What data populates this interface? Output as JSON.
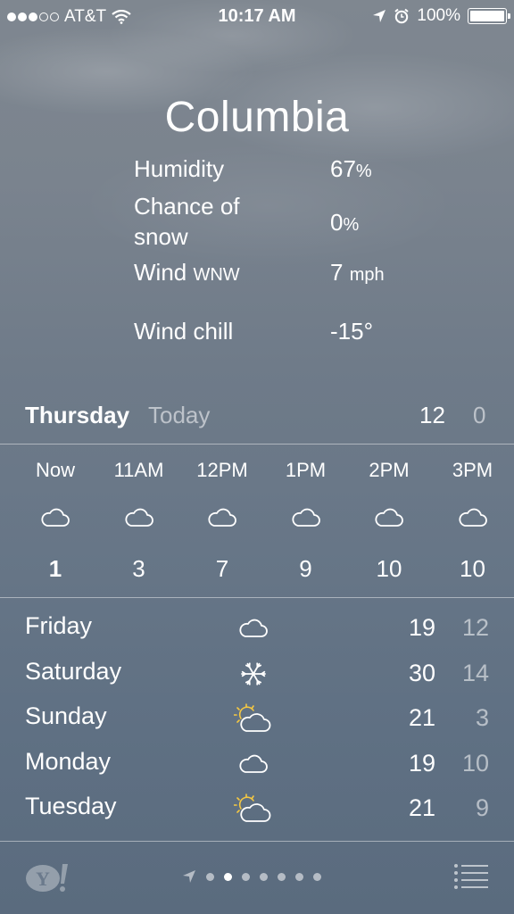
{
  "status_bar": {
    "carrier": "AT&T",
    "time": "10:17 AM",
    "battery": "100%",
    "signal_bars_filled": 3,
    "signal_bars_total": 5
  },
  "city": "Columbia",
  "details": {
    "humidity_label": "Humidity",
    "humidity_value": "67",
    "humidity_unit": "%",
    "snow_label": "Chance of snow",
    "snow_value": "0",
    "snow_unit": "%",
    "wind_label": "Wind",
    "wind_dir": "WNW",
    "wind_value": "7",
    "wind_unit": "mph",
    "windchill_label": "Wind chill",
    "windchill_value": "-15°"
  },
  "today": {
    "day": "Thursday",
    "label": "Today",
    "hi": "12",
    "lo": "0"
  },
  "hourly": [
    {
      "time": "Now",
      "icon": "cloud-icon",
      "temp": "1"
    },
    {
      "time": "11AM",
      "icon": "cloud-icon",
      "temp": "3"
    },
    {
      "time": "12PM",
      "icon": "cloud-icon",
      "temp": "7"
    },
    {
      "time": "1PM",
      "icon": "cloud-icon",
      "temp": "9"
    },
    {
      "time": "2PM",
      "icon": "cloud-icon",
      "temp": "10"
    },
    {
      "time": "3PM",
      "icon": "cloud-icon",
      "temp": "10"
    }
  ],
  "daily": [
    {
      "day": "Friday",
      "icon": "cloud-icon",
      "hi": "19",
      "lo": "12"
    },
    {
      "day": "Saturday",
      "icon": "snowflake-icon",
      "hi": "30",
      "lo": "14"
    },
    {
      "day": "Sunday",
      "icon": "partly-sunny-icon",
      "hi": "21",
      "lo": "3"
    },
    {
      "day": "Monday",
      "icon": "cloud-icon",
      "hi": "19",
      "lo": "10"
    },
    {
      "day": "Tuesday",
      "icon": "partly-sunny-icon",
      "hi": "21",
      "lo": "9"
    }
  ],
  "pager": {
    "pages": 7,
    "active_index": 1
  },
  "colors": {
    "sun": "#f5c842",
    "dim_text": "rgba(255,255,255,0.55)"
  }
}
